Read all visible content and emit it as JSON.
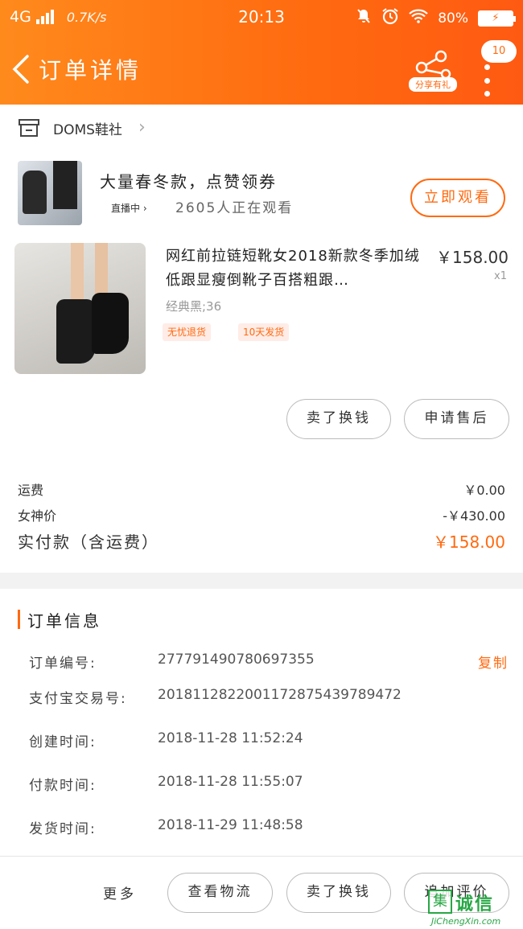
{
  "status_bar": {
    "network": "4G",
    "speed": "0.7K/s",
    "time": "20:13",
    "battery": "80%"
  },
  "nav": {
    "title": "订单详情",
    "share_label": "分享有礼",
    "message_count": "10"
  },
  "shop": {
    "name": "DOMS鞋社"
  },
  "live": {
    "title": "大量春冬款，点赞领券",
    "badge": "直播中",
    "viewers": "2605人正在观看",
    "watch_button": "立即观看"
  },
  "product": {
    "title": "网红前拉链短靴女2018新款冬季加绒低跟显瘦倒靴子百搭粗跟…",
    "price": "￥158.00",
    "quantity": "x1",
    "spec": "经典黑;36",
    "tags": [
      "无忧退货",
      "10天发货"
    ],
    "buttons": {
      "exchange": "卖了换钱",
      "after_sale": "申请售后"
    }
  },
  "summary": {
    "shipping_label": "运费",
    "shipping_value": "￥0.00",
    "discount_label": "女神价",
    "discount_value": "-￥430.00",
    "paid_label": "实付款（含运费）",
    "paid_value": "￥158.00"
  },
  "order_info": {
    "section_title": "订单信息",
    "copy_label": "复制",
    "rows": [
      {
        "key": "订单编号:",
        "value": "277791490780697355"
      },
      {
        "key": "支付宝交易号:",
        "value": "2018112822001172875439789472"
      },
      {
        "key": "创建时间:",
        "value": "2018-11-28  11:52:24"
      },
      {
        "key": "付款时间:",
        "value": "2018-11-28  11:55:07"
      },
      {
        "key": "发货时间:",
        "value": "2018-11-29  11:48:58"
      }
    ]
  },
  "bottom_bar": {
    "more": "更多",
    "logistics": "查看物流",
    "exchange": "卖了换钱",
    "review": "追加评价"
  },
  "watermark": {
    "box": "集",
    "text": "诚信",
    "url": "JiChengXin.com"
  },
  "colors": {
    "accent": "#ff6a10",
    "header_start": "#ff8a1c",
    "header_end": "#ff5a12",
    "watermark": "#28a745"
  }
}
